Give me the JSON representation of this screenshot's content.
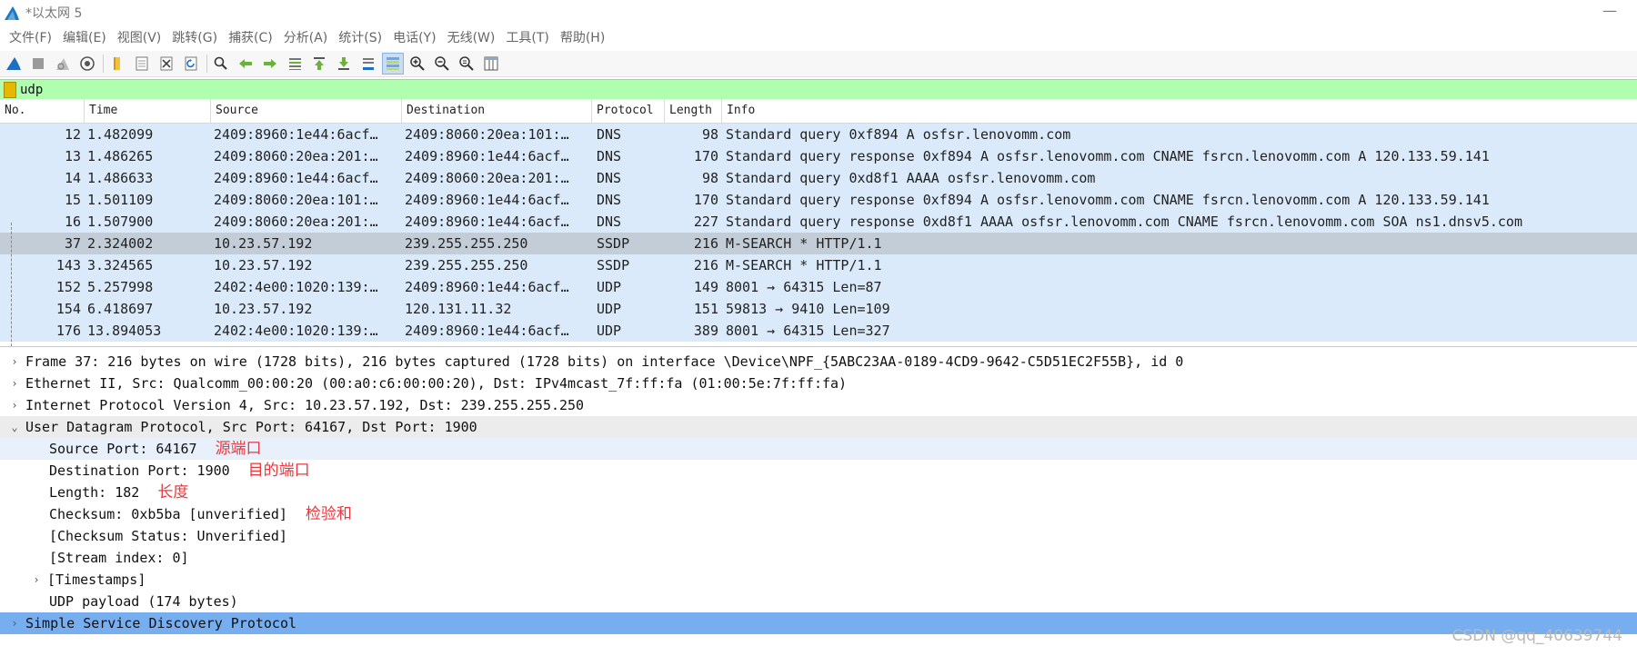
{
  "window": {
    "title": "*以太网 5",
    "minimize": "—"
  },
  "menu": [
    "文件(F)",
    "编辑(E)",
    "视图(V)",
    "跳转(G)",
    "捕获(C)",
    "分析(A)",
    "统计(S)",
    "电话(Y)",
    "无线(W)",
    "工具(T)",
    "帮助(H)"
  ],
  "toolbar": {
    "icons": [
      "shark-fin-start-icon",
      "stop-square-icon",
      "restart-fin-icon",
      "capture-options-gear-icon",
      "open-folder-icon",
      "save-file-icon",
      "close-file-icon",
      "reload-icon",
      "find-packet-icon",
      "go-back-icon",
      "go-forward-icon",
      "go-to-packet-icon",
      "go-first-icon",
      "go-last-icon",
      "autoscroll-icon",
      "colorize-icon",
      "zoom-in-icon",
      "zoom-out-icon",
      "zoom-normal-icon",
      "resize-columns-icon"
    ]
  },
  "filter": {
    "value": "udp"
  },
  "packet_list": {
    "columns": [
      "No.",
      "Time",
      "Source",
      "Destination",
      "Protocol",
      "Length",
      "Info"
    ],
    "rows": [
      {
        "no": "12",
        "time": "1.482099",
        "src": "2409:8960:1e44:6acf…",
        "dst": "2409:8060:20ea:101:…",
        "proto": "DNS",
        "len": "98",
        "info": "Standard query 0xf894 A osfsr.lenovomm.com"
      },
      {
        "no": "13",
        "time": "1.486265",
        "src": "2409:8060:20ea:201:…",
        "dst": "2409:8960:1e44:6acf…",
        "proto": "DNS",
        "len": "170",
        "info": "Standard query response 0xf894 A osfsr.lenovomm.com CNAME fsrcn.lenovomm.com A 120.133.59.141"
      },
      {
        "no": "14",
        "time": "1.486633",
        "src": "2409:8960:1e44:6acf…",
        "dst": "2409:8060:20ea:201:…",
        "proto": "DNS",
        "len": "98",
        "info": "Standard query 0xd8f1 AAAA osfsr.lenovomm.com"
      },
      {
        "no": "15",
        "time": "1.501109",
        "src": "2409:8060:20ea:101:…",
        "dst": "2409:8960:1e44:6acf…",
        "proto": "DNS",
        "len": "170",
        "info": "Standard query response 0xf894 A osfsr.lenovomm.com CNAME fsrcn.lenovomm.com A 120.133.59.141"
      },
      {
        "no": "16",
        "time": "1.507900",
        "src": "2409:8060:20ea:201:…",
        "dst": "2409:8960:1e44:6acf…",
        "proto": "DNS",
        "len": "227",
        "info": "Standard query response 0xd8f1 AAAA osfsr.lenovomm.com CNAME fsrcn.lenovomm.com SOA ns1.dnsv5.com"
      },
      {
        "no": "37",
        "time": "2.324002",
        "src": "10.23.57.192",
        "dst": "239.255.255.250",
        "proto": "SSDP",
        "len": "216",
        "info": "M-SEARCH * HTTP/1.1",
        "selected": true
      },
      {
        "no": "143",
        "time": "3.324565",
        "src": "10.23.57.192",
        "dst": "239.255.255.250",
        "proto": "SSDP",
        "len": "216",
        "info": "M-SEARCH * HTTP/1.1"
      },
      {
        "no": "152",
        "time": "5.257998",
        "src": "2402:4e00:1020:139:…",
        "dst": "2409:8960:1e44:6acf…",
        "proto": "UDP",
        "len": "149",
        "info": "8001 → 64315 Len=87"
      },
      {
        "no": "154",
        "time": "6.418697",
        "src": "10.23.57.192",
        "dst": "120.131.11.32",
        "proto": "UDP",
        "len": "151",
        "info": "59813 → 9410 Len=109"
      },
      {
        "no": "176",
        "time": "13.894053",
        "src": "2402:4e00:1020:139:…",
        "dst": "2409:8960:1e44:6acf…",
        "proto": "UDP",
        "len": "389",
        "info": "8001 → 64315 Len=327"
      }
    ]
  },
  "details": {
    "frame": "Frame 37: 216 bytes on wire (1728 bits), 216 bytes captured (1728 bits) on interface \\Device\\NPF_{5ABC23AA-0189-4CD9-9642-C5D51EC2F55B}, id 0",
    "ethernet": "Ethernet II, Src: Qualcomm_00:00:20 (00:a0:c6:00:00:20), Dst: IPv4mcast_7f:ff:fa (01:00:5e:7f:ff:fa)",
    "ip": "Internet Protocol Version 4, Src: 10.23.57.192, Dst: 239.255.255.250",
    "udp": "User Datagram Protocol, Src Port: 64167, Dst Port: 1900",
    "udp_fields": [
      {
        "text": "Source Port: 64167",
        "note": "源端口"
      },
      {
        "text": "Destination Port: 1900",
        "note": "目的端口"
      },
      {
        "text": "Length: 182",
        "note": "长度"
      },
      {
        "text": "Checksum: 0xb5ba [unverified]",
        "note": "检验和"
      },
      {
        "text": "[Checksum Status: Unverified]"
      },
      {
        "text": "[Stream index: 0]"
      }
    ],
    "timestamps": "[Timestamps]",
    "payload": "UDP payload (174 bytes)",
    "ssdp": "Simple Service Discovery Protocol"
  },
  "watermark": "CSDN @qq_40639744"
}
